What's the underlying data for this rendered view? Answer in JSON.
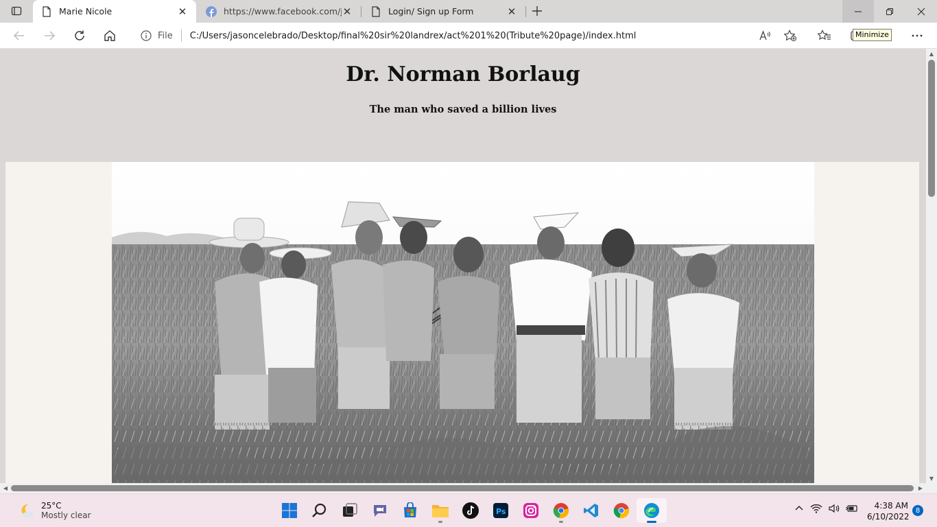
{
  "browser": {
    "tabs": [
      {
        "title": "Marie Nicole",
        "active": true,
        "icon": "page-icon"
      },
      {
        "title": "https://www.facebook.com/jasor",
        "active": false,
        "icon": "facebook-icon"
      },
      {
        "title": "Login/ Sign up Form",
        "active": false,
        "icon": "page-icon"
      }
    ],
    "address": {
      "scheme_label": "File",
      "url": "C:/Users/jasoncelebrado/Desktop/final%20sir%20landrex/act%201%20(Tribute%20page)/index.html"
    },
    "tooltip": "Minimize"
  },
  "page": {
    "title": "Dr. Norman Borlaug",
    "subtitle": "The man who saved a billion lives"
  },
  "taskbar": {
    "weather": {
      "temp": "25°C",
      "condition": "Mostly clear"
    },
    "time": "4:38 AM",
    "date": "6/10/2022",
    "notifications": "8"
  },
  "colors": {
    "page_background": "#dcd7d7",
    "image_panel": "#f6f3ef",
    "taskbar": "#f3e3ea",
    "accent": "#0067c0"
  }
}
